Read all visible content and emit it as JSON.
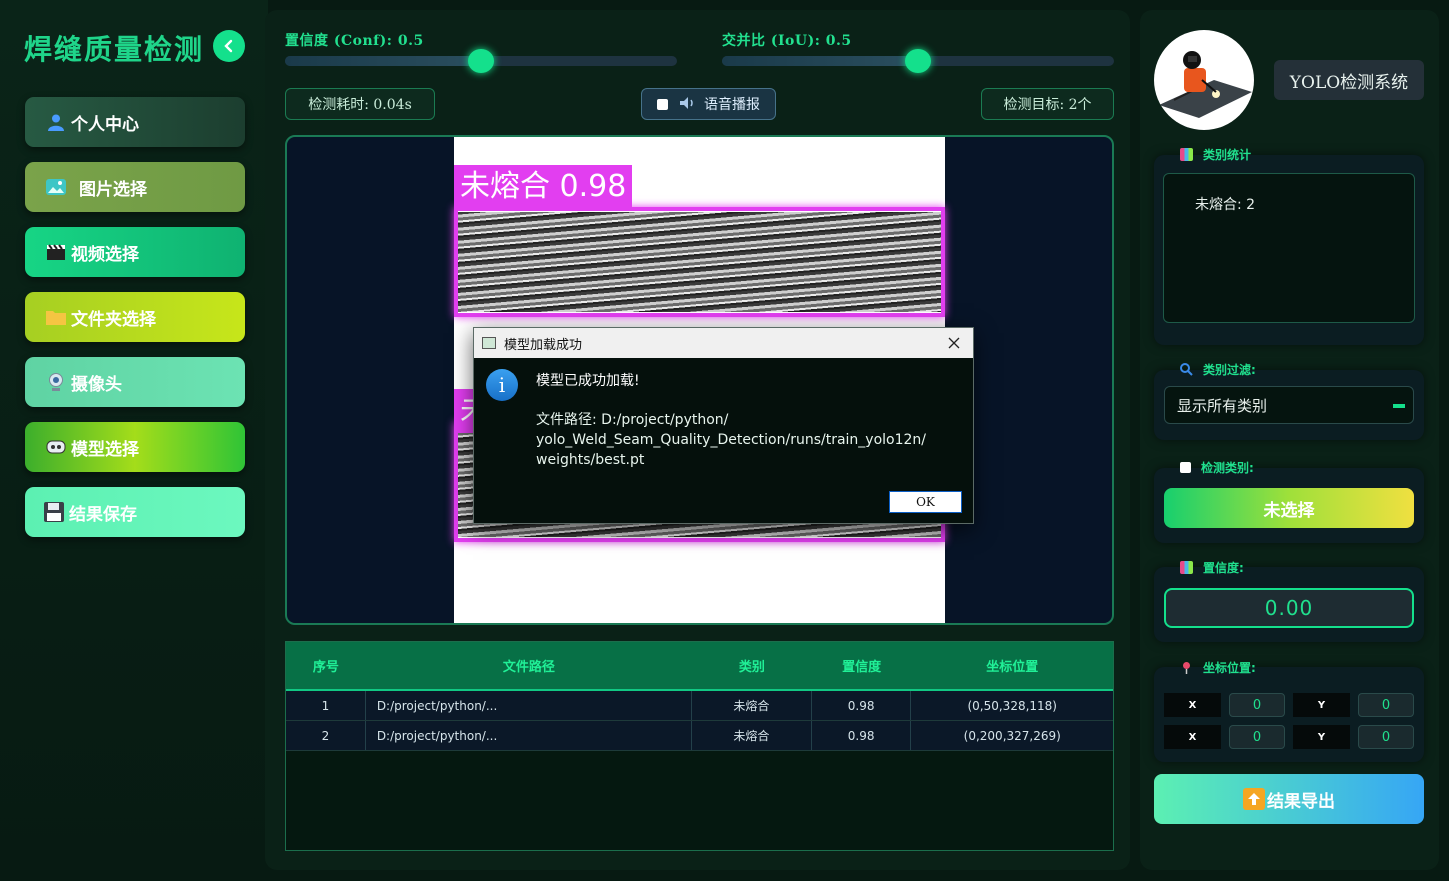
{
  "sidebar": {
    "title": "焊缝质量检测",
    "nav": [
      {
        "label": "个人中心",
        "icon": "user-icon"
      },
      {
        "label": "图片选择",
        "icon": "image-icon"
      },
      {
        "label": "视频选择",
        "icon": "clapper-icon"
      },
      {
        "label": "文件夹选择",
        "icon": "folder-icon"
      },
      {
        "label": "摄像头",
        "icon": "webcam-icon"
      },
      {
        "label": "模型选择",
        "icon": "model-icon"
      },
      {
        "label": "结果保存",
        "icon": "floppy-icon"
      }
    ]
  },
  "controls": {
    "conf_label": "置信度 (Conf): 0.5",
    "conf_value": 0.5,
    "iou_label": "交并比 (IoU): 0.5",
    "iou_value": 0.5,
    "time_label": "检测耗时: 0.04s",
    "voice_label": "语音播报",
    "target_label": "检测目标: 2个"
  },
  "detections_overlay": [
    {
      "label": "未熔合 0.98"
    },
    {
      "label": "未"
    }
  ],
  "dialog": {
    "title": "模型加载成功",
    "message": "模型已成功加载!",
    "path_line1": "文件路径: D:/project/python/",
    "path_line2": "yolo_Weld_Seam_Quality_Detection/runs/train_yolo12n/",
    "path_line3": "weights/best.pt",
    "ok": "OK"
  },
  "table": {
    "headers": [
      "序号",
      "文件路径",
      "类别",
      "置信度",
      "坐标位置"
    ],
    "rows": [
      [
        "1",
        "D:/project/python/...",
        "未熔合",
        "0.98",
        "(0,50,328,118)"
      ],
      [
        "2",
        "D:/project/python/...",
        "未熔合",
        "0.98",
        "(0,200,327,269)"
      ]
    ]
  },
  "right": {
    "system_name": "YOLO检测系统",
    "stats_title": "类别统计",
    "stats_text": "未熔合: 2",
    "filter_title": "类别过滤:",
    "filter_value": "显示所有类别",
    "detect_title": "检测类别:",
    "detect_value": "未选择",
    "conf_title": "置信度:",
    "conf_value": "0.00",
    "coord_title": "坐标位置:",
    "coords": {
      "x1": "X",
      "y1": "Y",
      "x2": "X",
      "y2": "Y",
      "v1": "0",
      "v2": "0",
      "v3": "0",
      "v4": "0"
    },
    "export_label": "结果导出"
  },
  "colors": {
    "accent": "#14e08c",
    "detection": "#e23ef0",
    "background": "#071a12"
  }
}
